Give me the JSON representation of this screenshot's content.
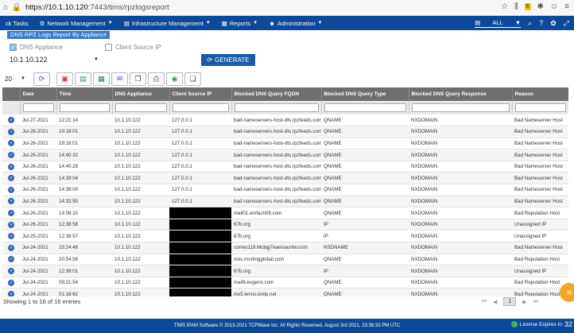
{
  "browser": {
    "url_host": "https://10.1.10.120",
    "url_path": ":7443/tims/rpzlogsreport",
    "badge": "6"
  },
  "nav": {
    "items": [
      {
        "label": "ck Tasks"
      },
      {
        "label": "Network Management"
      },
      {
        "label": "Infrastructure Management"
      },
      {
        "label": "Reports"
      },
      {
        "label": "Administration"
      }
    ],
    "site_value": "ALL"
  },
  "page": {
    "title": "DNS RPZ Logs Report By Appliance",
    "dns_appliance_label": "DNS Appliance",
    "client_source_ip_label": "Client Source IP",
    "appliance_value": "10.1.10.122",
    "generate_label": "GENERATE",
    "page_size": "20"
  },
  "table": {
    "columns": [
      "",
      "Date",
      "Time",
      "DNS Appliance",
      "Client Source IP",
      "Blocked DNS Query FQDN",
      "Blocked DNS Query Type",
      "Blocked DNS Query Response",
      "Reason"
    ],
    "rows": [
      [
        "Jul-27-2021",
        "12:21:14",
        "10.1.10.122",
        "127.0.0.1",
        "bad-nameservers-host-dts.rpzfeeds.com",
        "QNAME",
        "NXDOMAIN",
        "Bad Nameserver Host"
      ],
      [
        "Jul-26-2021",
        "19:18:01",
        "10.1.10.122",
        "127.0.0.1",
        "bad-nameservers-host-dts.rpzfeeds.com",
        "QNAME",
        "NXDOMAIN",
        "Bad Nameserver Host"
      ],
      [
        "Jul-26-2021",
        "19:18:01",
        "10.1.10.122",
        "127.0.0.1",
        "bad-nameservers-host-dts.rpzfeeds.com",
        "QNAME",
        "NXDOMAIN",
        "Bad Nameserver Host"
      ],
      [
        "Jul-26-2021",
        "14:40:32",
        "10.1.10.122",
        "127.0.0.1",
        "bad-nameservers-host-dts.rpzfeeds.com",
        "QNAME",
        "NXDOMAIN",
        "Bad Nameserver Host"
      ],
      [
        "Jul-26-2021",
        "14:40:28",
        "10.1.10.122",
        "127.0.0.1",
        "bad-nameservers-host-dts.rpzfeeds.com",
        "QNAME",
        "NXDOMAIN",
        "Bad Nameserver Host"
      ],
      [
        "Jul-26-2021",
        "14:39:04",
        "10.1.10.122",
        "127.0.0.1",
        "bad-nameservers-host-dts.rpzfeeds.com",
        "QNAME",
        "NXDOMAIN",
        "Bad Nameserver Host"
      ],
      [
        "Jul-26-2021",
        "14:39:00",
        "10.1.10.122",
        "127.0.0.1",
        "bad-nameservers-host-dts.rpzfeeds.com",
        "QNAME",
        "NXDOMAIN",
        "Bad Nameserver Host"
      ],
      [
        "Jul-26-2021",
        "14:32:50",
        "10.1.10.122",
        "127.0.0.1",
        "bad-nameservers-host-dts.rpzfeeds.com",
        "QNAME",
        "NXDOMAIN",
        "Bad Nameserver Host"
      ],
      [
        "Jul-26-2021",
        "14:08:10",
        "10.1.10.122",
        "",
        "mail01.einfach09.com",
        "QNAME",
        "NXDOMAIN",
        "Bad Reputation Host"
      ],
      [
        "Jul-26-2021",
        "12:38:58",
        "10.1.10.122",
        "",
        "67b.org",
        "IP",
        "NXDOMAIN",
        "Unassigned IP"
      ],
      [
        "Jul-25-2021",
        "12:38:57",
        "10.1.10.122",
        "",
        "67b.org",
        "IP",
        "NXDOMAIN",
        "Unassigned IP"
      ],
      [
        "Jul-24-2021",
        "23:24:46",
        "10.1.10.122",
        "",
        "correo118.Mcbgj7eawsaunlw.com",
        "NSDNAME",
        "NXDOMAIN",
        "Bad Nameserver Host"
      ],
      [
        "Jul-24-2021",
        "20:54:58",
        "10.1.10.122",
        "",
        "mxs.morlingglobal.com",
        "QNAME",
        "NXDOMAIN",
        "Bad Reputation Host"
      ],
      [
        "Jul-24-2021",
        "12:39:01",
        "10.1.10.122",
        "",
        "67b.org",
        "IP",
        "NXDOMAIN",
        "Unassigned IP"
      ],
      [
        "Jul-24-2021",
        "09:21:54",
        "10.1.10.122",
        "",
        "mail6.eugenx.com",
        "QNAME",
        "NXDOMAIN",
        "Bad Reputation Host"
      ],
      [
        "Jul-24-2021",
        "01:16:62",
        "10.1.10.122",
        "",
        "mx5.lenno.kmlp.net",
        "QNAME",
        "NXDOMAIN",
        "Bad Reputation Host"
      ]
    ]
  },
  "footer": {
    "info": "Showing 1 to 16 of 16 entries",
    "current_page": "1",
    "copyright": "TIMS IPAM Software © 2013-2021 TCPWave Inc. All Rights Reserved. August 3rd 2021, 23:36:33 PM UTC",
    "license_label": "License Expires In",
    "license_days": "32"
  },
  "colors": {
    "nav": "#0b4a9a",
    "header": "#6e6e6e",
    "accent": "#1a5aa8"
  }
}
